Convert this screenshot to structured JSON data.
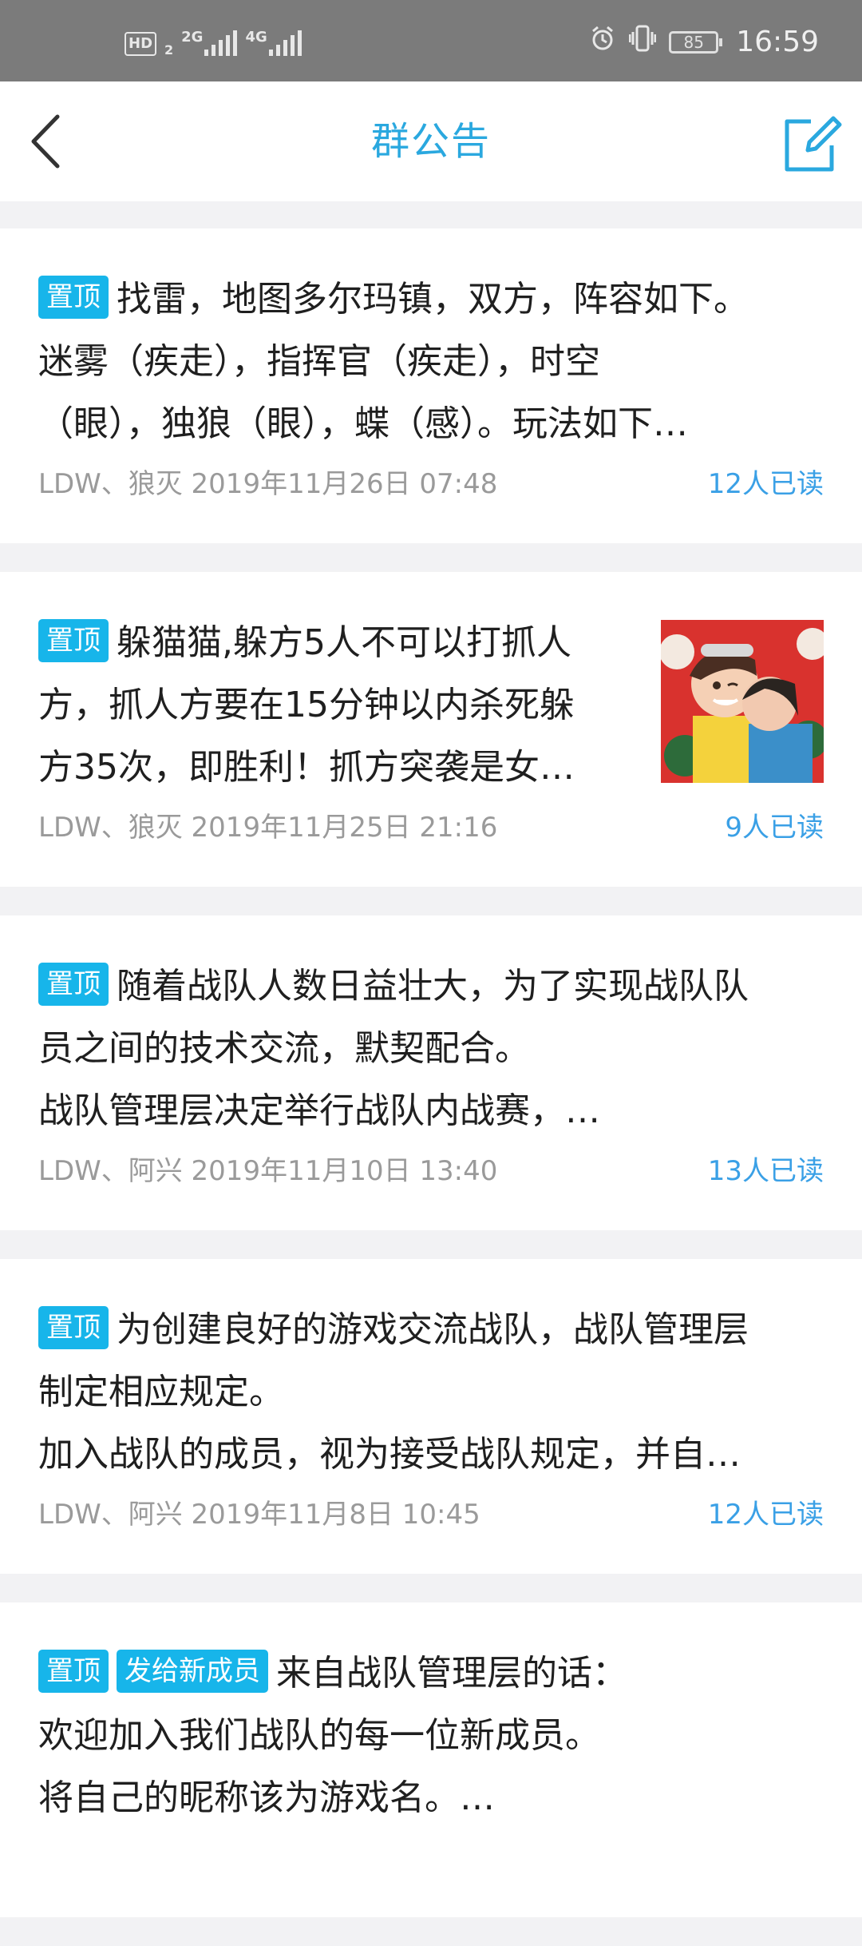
{
  "status_bar": {
    "hd_label": "HD",
    "hd_sub": "2",
    "net1": "2G",
    "net2": "4G",
    "battery": "85",
    "time": "16:59"
  },
  "header": {
    "title": "群公告"
  },
  "announcements": [
    {
      "tags": [
        "置顶"
      ],
      "lines": [
        "找雷，地图多尔玛镇，双方，阵容如下。",
        "迷雾（疾走），指挥官（疾走），时空",
        "（眼），独狼（眼），蝶（感）。玩法如下…"
      ],
      "meta": "LDW、狼灭 2019年11月26日 07:48",
      "read": "12人已读"
    },
    {
      "tags": [
        "置顶"
      ],
      "lines": [
        "躲猫猫,躲方5人不可以打抓人",
        "方，抓人方要在15分钟以内杀死躲",
        "方35次，即胜利！抓方突袭是女…"
      ],
      "meta": "LDW、狼灭 2019年11月25日 21:16",
      "read": "9人已读",
      "has_image": true
    },
    {
      "tags": [
        "置顶"
      ],
      "lines": [
        "随着战队人数日益壮大，为了实现战队队",
        "员之间的技术交流，默契配合。",
        "战队管理层决定举行战队内战赛，…"
      ],
      "meta": "LDW、阿兴 2019年11月10日 13:40",
      "read": "13人已读"
    },
    {
      "tags": [
        "置顶"
      ],
      "lines": [
        "为创建良好的游戏交流战队，战队管理层",
        "制定相应规定。",
        "加入战队的成员，视为接受战队规定，并自…"
      ],
      "meta": "LDW、阿兴 2019年11月8日 10:45",
      "read": "12人已读"
    },
    {
      "tags": [
        "置顶",
        "发给新成员"
      ],
      "lines": [
        "来自战队管理层的话：",
        "欢迎加入我们战队的每一位新成员。",
        "将自己的昵称该为游戏名。…"
      ],
      "meta": "",
      "read": ""
    }
  ],
  "colors": {
    "accent": "#2aa8df",
    "tag_bg": "#17b5ea",
    "read_count": "#3aa0e6",
    "meta_gray": "#9a9a9a",
    "status_bar_bg": "#7b7b7b"
  }
}
